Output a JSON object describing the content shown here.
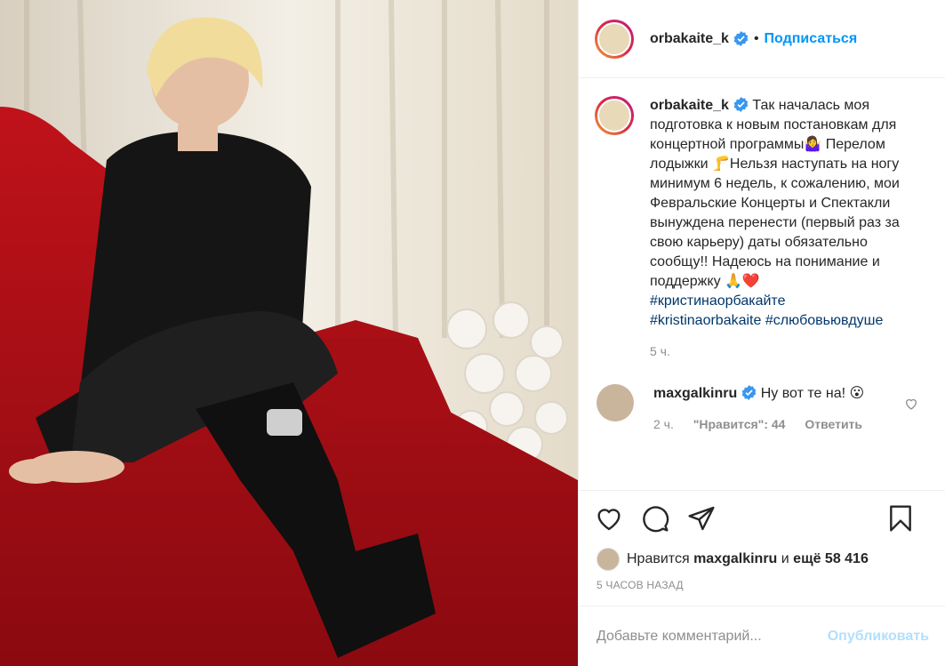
{
  "header": {
    "username": "orbakaite_k",
    "separator": "•",
    "follow_label": "Подписаться"
  },
  "caption": {
    "username": "orbakaite_k",
    "text": "Так началась моя подготовка к новым постановкам для концертной программы🤷‍♀️ Перелом лодыжки 🦵Нельзя наступать на ногу минимум 6 недель, к сожалению, мои Февральские Концерты и Спектакли вынуждена перенести (первый раз за свою карьеру) даты обязательно сообщу!! Надеюсь на понимание и поддержку 🙏❤️",
    "hashtags": [
      "#кристинаорбакайте",
      "#kristinaorbakaite",
      "#слюбовьювдуше"
    ],
    "time": "5 ч."
  },
  "comment": {
    "username": "maxgalkinru",
    "text": "Ну вот те на! 😮",
    "time": "2 ч.",
    "likes_label": "\"Нравится\": 44",
    "reply_label": "Ответить"
  },
  "likes": {
    "prefix": "Нравится",
    "user": "maxgalkinru",
    "middle": "и",
    "count": "ещё 58 416"
  },
  "timestamp": "5 ЧАСОВ НАЗАД",
  "add_comment": {
    "placeholder": "Добавьте комментарий...",
    "publish_label": "Опубликовать"
  },
  "icons": {
    "like": "heart-icon",
    "comment": "comment-icon",
    "share": "share-icon",
    "save": "bookmark-icon",
    "verified": "verified-badge-icon"
  },
  "colors": {
    "link": "#0095f6",
    "hashtag": "#00376b",
    "muted": "#8e8e8e",
    "verified": "#3897f0",
    "publish_disabled": "#b2dffc"
  }
}
